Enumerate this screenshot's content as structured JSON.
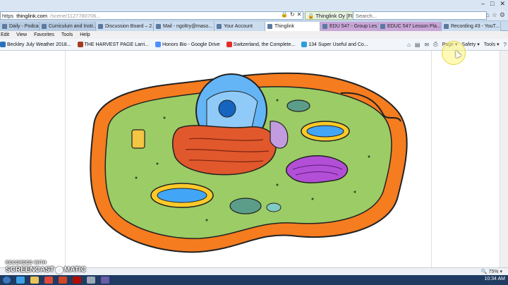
{
  "window": {
    "controls": [
      "–",
      "□",
      "✕"
    ]
  },
  "address": {
    "prefix": "https",
    "host": "thinglink.com",
    "path": "/scene/1127780706...",
    "site_identity": "Thinglink Oy [FI]",
    "search_placeholder": "Search...",
    "search_icon": "search-icon"
  },
  "tabs": [
    {
      "label": "Daily - Podcasts",
      "color": "#b7cbe3"
    },
    {
      "label": "Curriculum and Instr...",
      "color": "#b7cbe3"
    },
    {
      "label": "Discussion Board – 2...",
      "color": "#cbdcef"
    },
    {
      "label": "Mail - ngoltry@maso...",
      "color": "#cbdcef"
    },
    {
      "label": "Your Account",
      "color": "#cbdcef"
    },
    {
      "label": "Thinglink",
      "color": "#ffffff",
      "active": true
    },
    {
      "label": "EDU 547 - Group Les...",
      "color": "#c9a6d8"
    },
    {
      "label": "EDUC 547 Lesson Pla...",
      "color": "#c9a6d8"
    },
    {
      "label": "Recording #3 - YouT...",
      "color": "#cbdcef"
    }
  ],
  "menu": [
    "Edit",
    "View",
    "Favorites",
    "Tools",
    "Help"
  ],
  "favorites": [
    {
      "label": "Beckley July Weather 2018...",
      "color": "#2a6fbf"
    },
    {
      "label": "THE HARVEST PAGE  Larri...",
      "color": "#a63b1f"
    },
    {
      "label": "Honors Bio - Google Drive",
      "color": "#4d90fe"
    },
    {
      "label": "Switzerland, the Complete...",
      "color": "#e52d27"
    },
    {
      "label": "134 Super Useful and Co...",
      "color": "#2d9cdb"
    }
  ],
  "commands": [
    "Page",
    "Safety",
    "Tools"
  ],
  "status": {
    "zoom": "75%"
  },
  "taskbar": {
    "time": "10:34 AM"
  },
  "watermark": {
    "top": "RECORDED WITH",
    "left": "SCREENCAST",
    "right": "MATIC"
  },
  "colors": {
    "cytoplasm": "#9ccc65",
    "membrane": "#f57c1f",
    "nucleus": "#64b5f6",
    "er": "#e0582c",
    "golgi": "#b24fd6",
    "mitochondria_outer": "#ffca28",
    "mitochondria_inner": "#42a5f5"
  }
}
